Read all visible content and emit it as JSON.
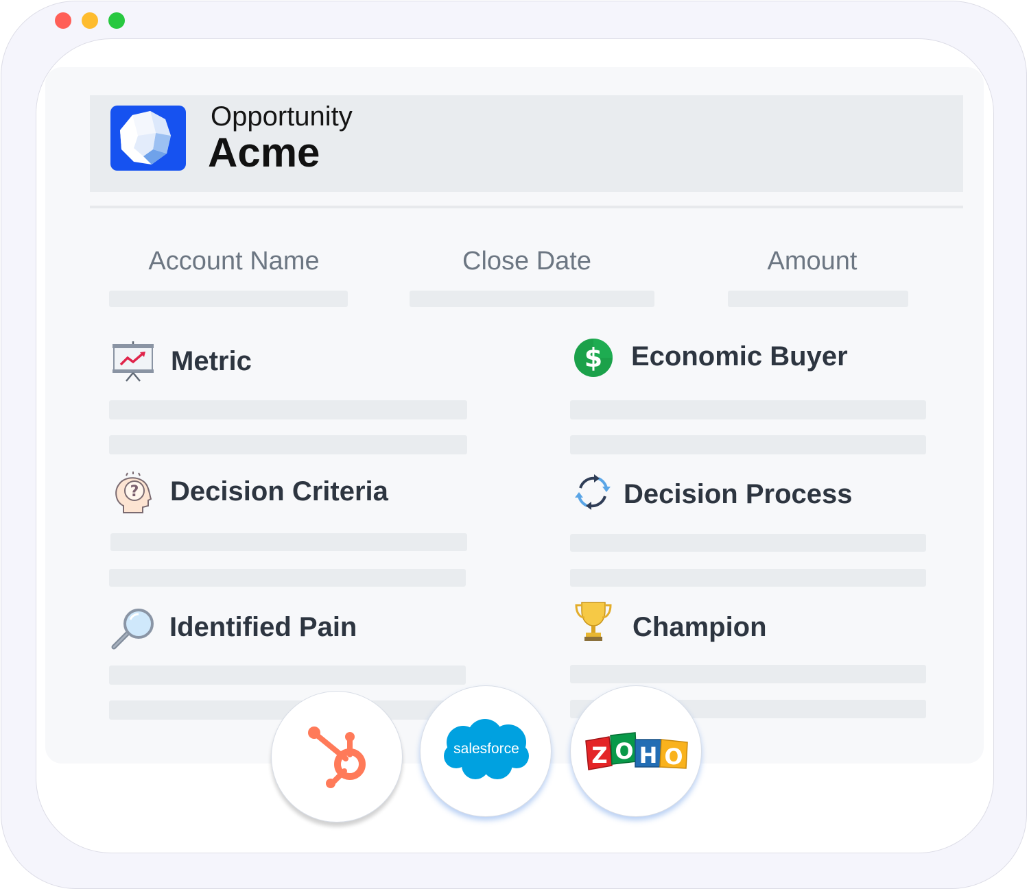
{
  "window": {
    "controls": [
      "close",
      "minimize",
      "maximize"
    ]
  },
  "header": {
    "logo_icon": "gem-logo-icon",
    "label": "Opportunity",
    "title": "Acme"
  },
  "columns": [
    {
      "label": "Account Name"
    },
    {
      "label": "Close Date"
    },
    {
      "label": "Amount"
    }
  ],
  "sections": {
    "metric": {
      "title": "Metric",
      "icon": "chart-presentation-icon"
    },
    "economic_buyer": {
      "title": "Economic Buyer",
      "icon": "dollar-icon"
    },
    "decision_criteria": {
      "title": "Decision Criteria",
      "icon": "thinking-head-icon"
    },
    "decision_process": {
      "title": "Decision Process",
      "icon": "refresh-cycle-icon"
    },
    "identified_pain": {
      "title": "Identified Pain",
      "icon": "magnifier-icon"
    },
    "champion": {
      "title": "Champion",
      "icon": "trophy-icon"
    }
  },
  "integrations": [
    {
      "name": "hubspot",
      "icon": "hubspot-logo-icon"
    },
    {
      "name": "salesforce",
      "wordmark": "salesforce",
      "icon": "salesforce-logo-icon"
    },
    {
      "name": "zoho",
      "letters": [
        "Z",
        "O",
        "H",
        "O"
      ],
      "icon": "zoho-logo-icon"
    }
  ],
  "colors": {
    "logo_blue": "#1652f0",
    "hubspot_orange": "#ff7a59",
    "salesforce_blue": "#00a1e0",
    "dollar_green": "#1ba14a"
  }
}
